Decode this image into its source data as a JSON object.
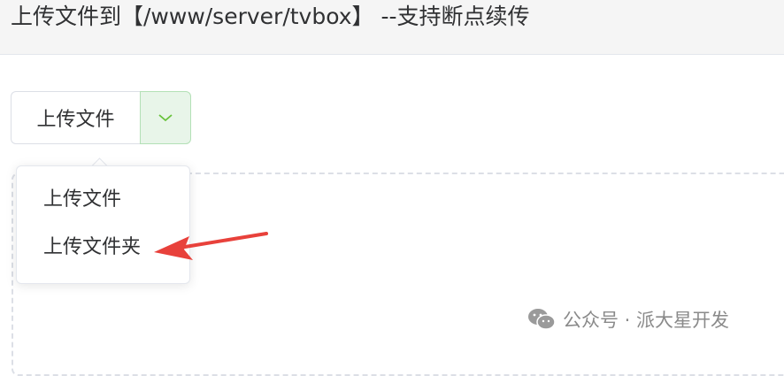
{
  "header": {
    "title": "上传文件到【/www/server/tvbox】 --支持断点续传"
  },
  "upload_button": {
    "label": "上传文件",
    "dropdown_icon": "chevron-down-icon"
  },
  "dropdown_menu": {
    "items": [
      {
        "label": "上传文件"
      },
      {
        "label": "上传文件夹"
      }
    ]
  },
  "annotation": {
    "icon": "red-arrow-icon",
    "color": "#e8413b"
  },
  "watermark": {
    "icon": "wechat-icon",
    "text": "公众号 · 派大星开发"
  },
  "colors": {
    "accent_green": "#67c23a",
    "border": "#dcdfe6"
  }
}
